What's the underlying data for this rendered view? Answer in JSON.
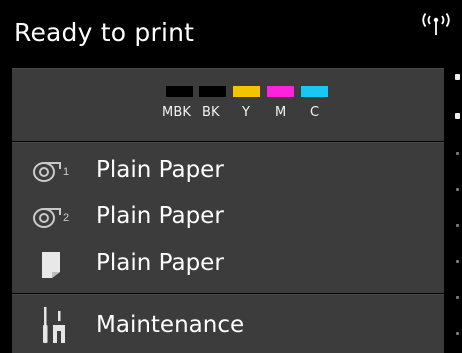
{
  "status": {
    "text": "Ready to print",
    "wifi_icon": "wifi-antenna-icon"
  },
  "inks": [
    {
      "label": "MBK",
      "color": "#000000"
    },
    {
      "label": "BK",
      "color": "#000000"
    },
    {
      "label": "Y",
      "color": "#f5c400"
    },
    {
      "label": "M",
      "color": "#ff22dd"
    },
    {
      "label": "C",
      "color": "#18c8f3"
    }
  ],
  "media": [
    {
      "label": "Plain Paper",
      "source": "roll-1",
      "icon": "roll-paper-1-icon"
    },
    {
      "label": "Plain Paper",
      "source": "roll-2",
      "icon": "roll-paper-2-icon"
    },
    {
      "label": "Plain Paper",
      "source": "sheet",
      "icon": "cut-sheet-icon"
    }
  ],
  "maintenance": {
    "label": "Maintenance",
    "icon": "tools-icon"
  },
  "colors": {
    "background": "#000000",
    "panel": "#3c3c3c",
    "text": "#ffffff"
  }
}
